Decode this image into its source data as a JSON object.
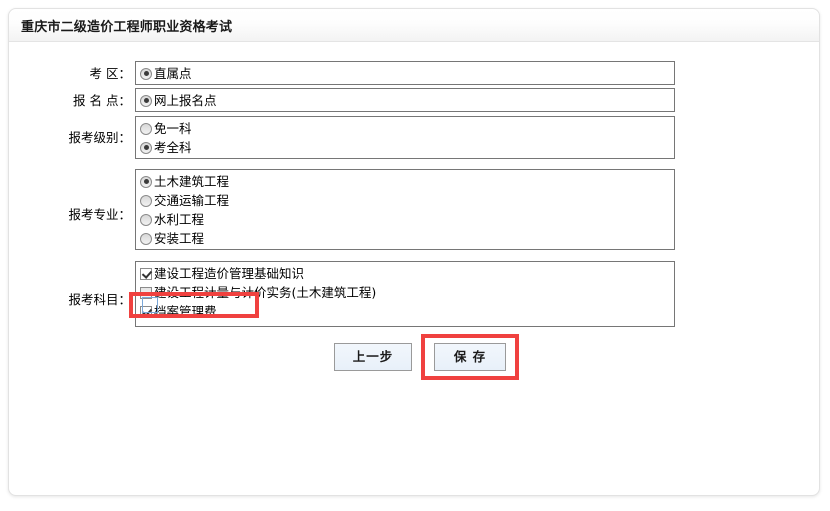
{
  "panel": {
    "title": "重庆市二级造价工程师职业资格考试"
  },
  "form": {
    "rows": [
      {
        "label": "考 区：",
        "type": "radio",
        "options": [
          {
            "text": "直属点",
            "checked": true
          }
        ]
      },
      {
        "label": "报 名 点：",
        "type": "radio",
        "options": [
          {
            "text": "网上报名点",
            "checked": true
          }
        ]
      },
      {
        "label": "报考级别：",
        "type": "radio",
        "options": [
          {
            "text": "免一科",
            "checked": false
          },
          {
            "text": "考全科",
            "checked": true
          }
        ]
      },
      {
        "label": "报考专业：",
        "type": "radio",
        "options": [
          {
            "text": "土木建筑工程",
            "checked": true
          },
          {
            "text": "交通运输工程",
            "checked": false
          },
          {
            "text": "水利工程",
            "checked": false
          },
          {
            "text": "安装工程",
            "checked": false
          }
        ]
      },
      {
        "label": "报考科目：",
        "type": "checkbox",
        "options": [
          {
            "text": "建设工程造价管理基础知识",
            "checked": true
          },
          {
            "text": "建设工程计量与计价实务(土木建筑工程)",
            "checked": false
          },
          {
            "text": "档案管理费",
            "checked": true
          }
        ]
      }
    ]
  },
  "buttons": {
    "prev_label": "上一步",
    "save_label": "保 存"
  },
  "annotations": {
    "highlight_color": "#f0413f",
    "highlighted_items": [
      "档案管理费",
      "保 存"
    ]
  }
}
